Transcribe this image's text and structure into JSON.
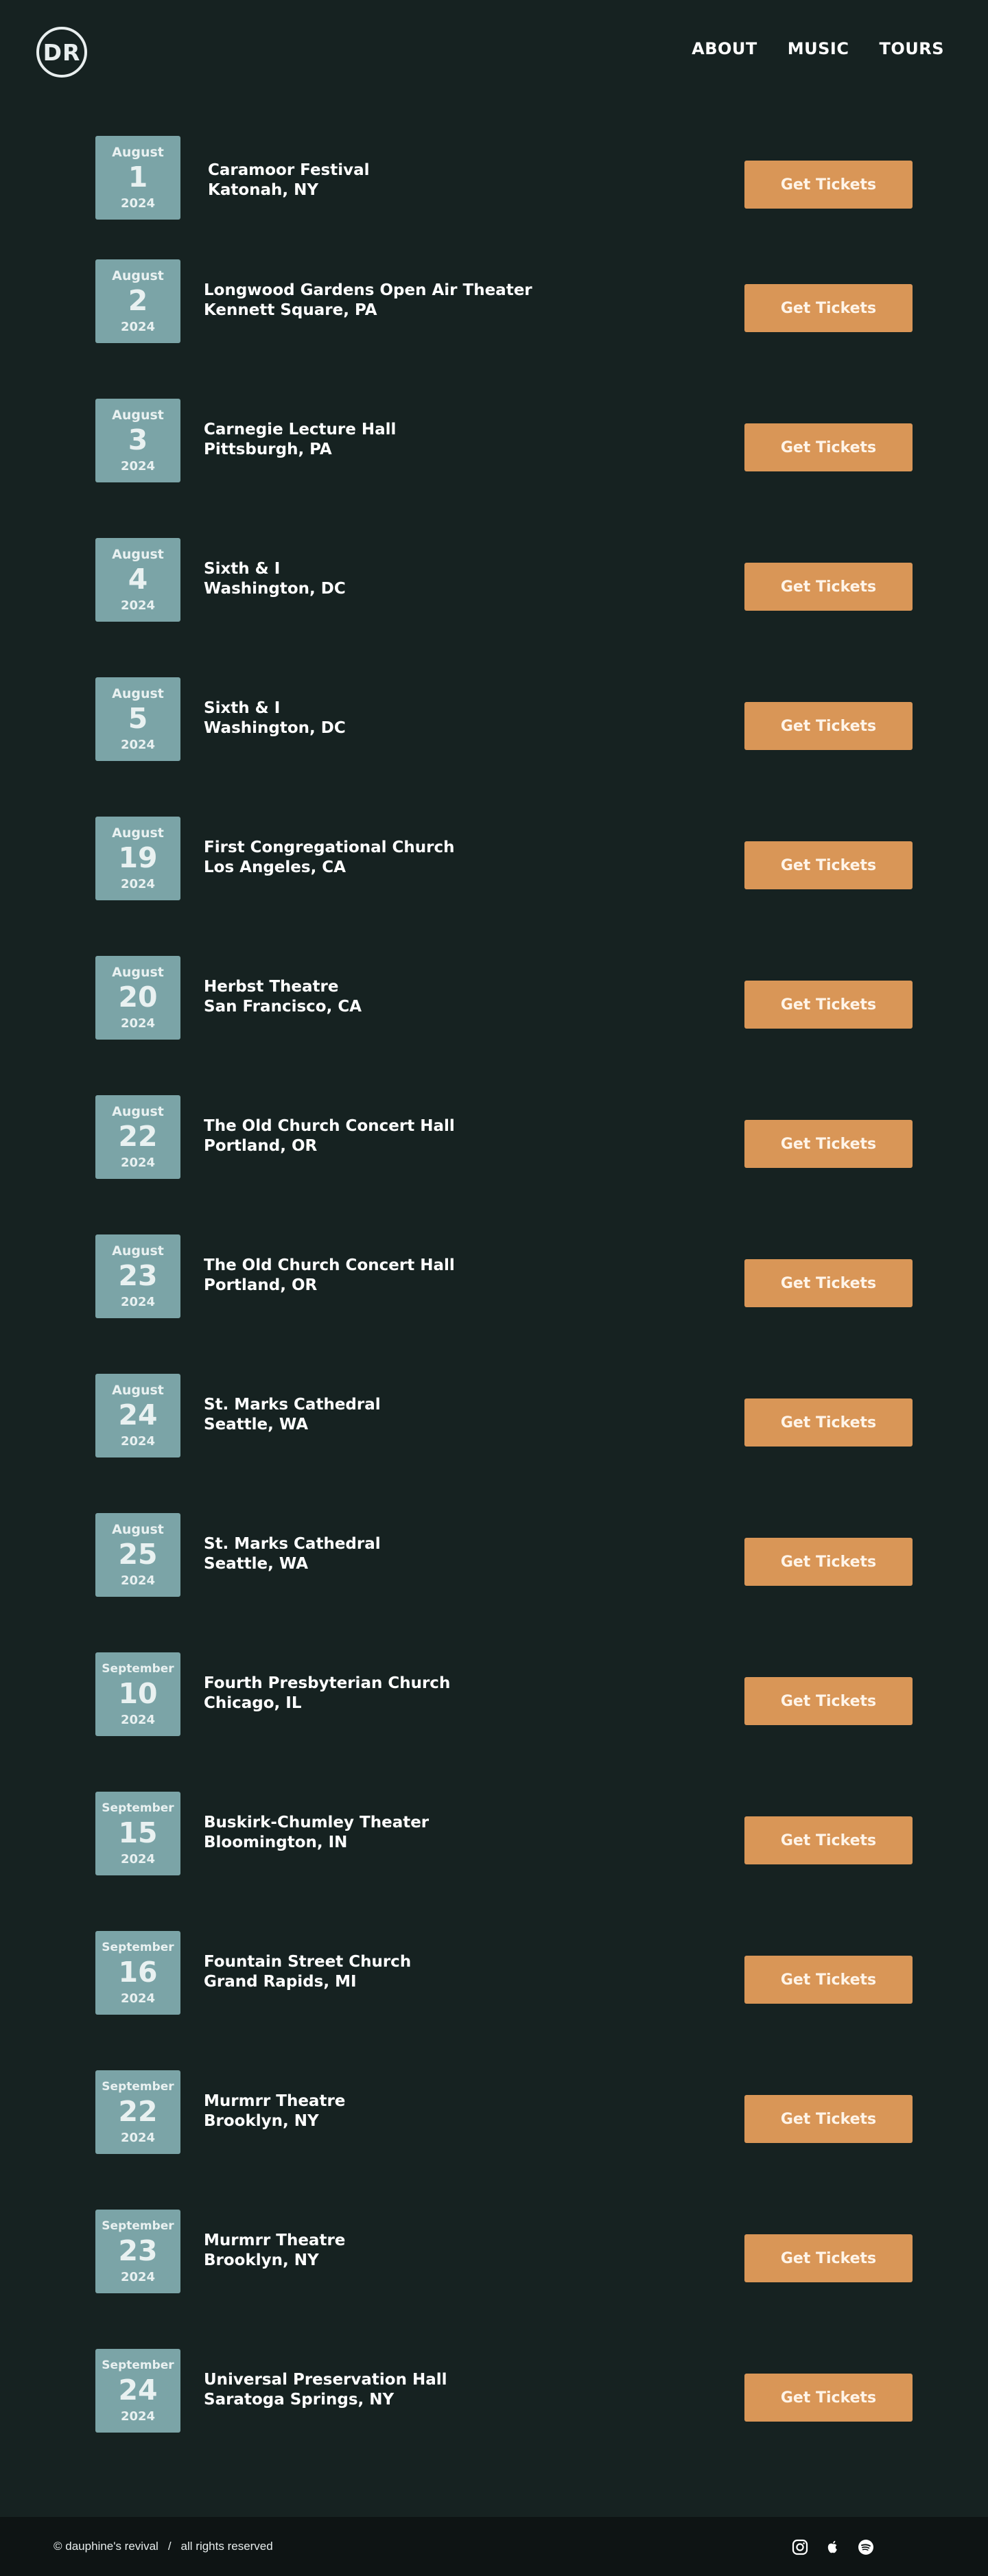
{
  "logo": "DR",
  "nav": [
    {
      "label": "ABOUT"
    },
    {
      "label": "MUSIC"
    },
    {
      "label": "TOURS"
    }
  ],
  "ticket_label": "Get Tickets",
  "events": [
    {
      "month": "August",
      "day": "1",
      "year": "2024",
      "venue": "Caramoor Festival",
      "location": "Katonah, NY"
    },
    {
      "month": "August",
      "day": "2",
      "year": "2024",
      "venue": "Longwood Gardens Open Air Theater",
      "location": "Kennett Square, PA"
    },
    {
      "month": "August",
      "day": "3",
      "year": "2024",
      "venue": "Carnegie Lecture Hall",
      "location": "Pittsburgh, PA"
    },
    {
      "month": "August",
      "day": "4",
      "year": "2024",
      "venue": "Sixth & I",
      "location": "Washington, DC"
    },
    {
      "month": "August",
      "day": "5",
      "year": "2024",
      "venue": "Sixth & I",
      "location": "Washington, DC"
    },
    {
      "month": "August",
      "day": "19",
      "year": "2024",
      "venue": "First Congregational Church",
      "location": "Los Angeles, CA"
    },
    {
      "month": "August",
      "day": "20",
      "year": "2024",
      "venue": "Herbst Theatre",
      "location": "San Francisco, CA"
    },
    {
      "month": "August",
      "day": "22",
      "year": "2024",
      "venue": "The Old Church Concert Hall",
      "location": "Portland, OR"
    },
    {
      "month": "August",
      "day": "23",
      "year": "2024",
      "venue": "The Old Church Concert Hall",
      "location": "Portland, OR"
    },
    {
      "month": "August",
      "day": "24",
      "year": "2024",
      "venue": "St. Marks Cathedral",
      "location": "Seattle, WA"
    },
    {
      "month": "August",
      "day": "25",
      "year": "2024",
      "venue": "St. Marks Cathedral",
      "location": "Seattle, WA"
    },
    {
      "month": "September",
      "day": "10",
      "year": "2024",
      "venue": "Fourth Presbyterian Church",
      "location": "Chicago, IL"
    },
    {
      "month": "September",
      "day": "15",
      "year": "2024",
      "venue": "Buskirk-Chumley Theater",
      "location": "Bloomington, IN"
    },
    {
      "month": "September",
      "day": "16",
      "year": "2024",
      "venue": "Fountain Street Church",
      "location": "Grand Rapids, MI"
    },
    {
      "month": "September",
      "day": "22",
      "year": "2024",
      "venue": "Murmrr Theatre",
      "location": "Brooklyn, NY"
    },
    {
      "month": "September",
      "day": "23",
      "year": "2024",
      "venue": "Murmrr Theatre",
      "location": "Brooklyn, NY"
    },
    {
      "month": "September",
      "day": "24",
      "year": "2024",
      "venue": "Universal Preservation Hall",
      "location": "Saratoga Springs, NY"
    }
  ],
  "footer": {
    "copyright": "© dauphine's revival",
    "separator": "/",
    "rights": "all rights reserved",
    "icons": [
      "instagram-icon",
      "apple-icon",
      "spotify-icon"
    ]
  },
  "colors": {
    "background": "#162221",
    "date_box": "#7ba4a7",
    "button": "#d99657",
    "footer": "#0e1414"
  }
}
